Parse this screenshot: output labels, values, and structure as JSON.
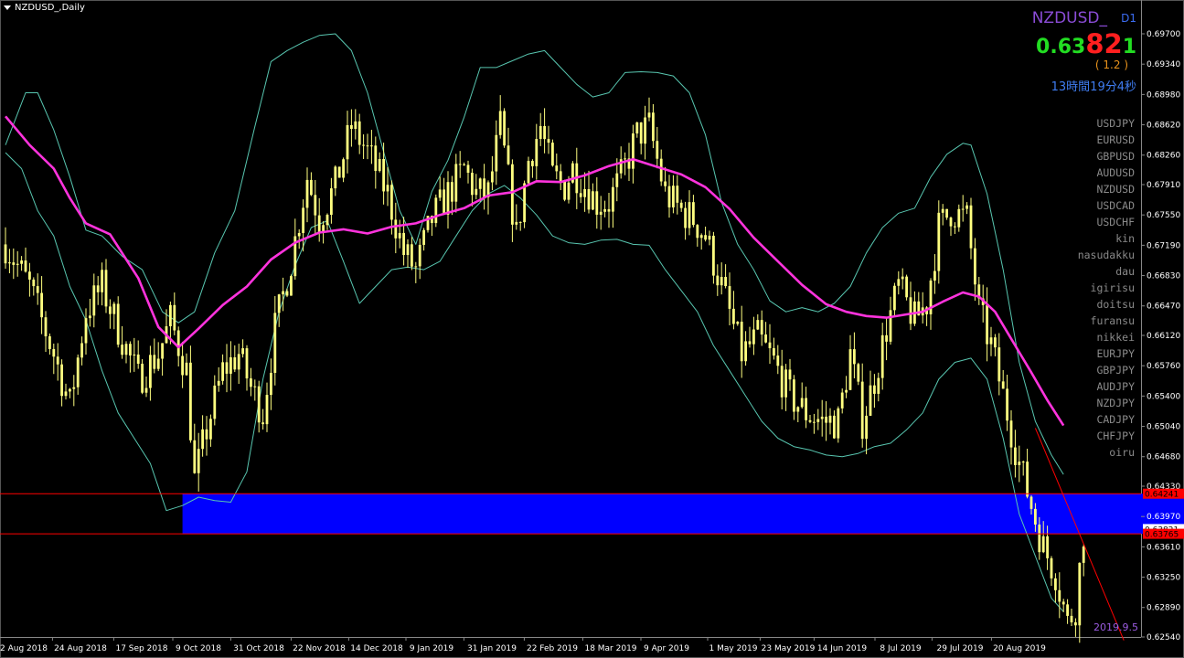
{
  "window": {
    "title": "NZDUSD_,Daily"
  },
  "info": {
    "symbol": "NZDUSD_",
    "timeframe": "D1",
    "bid_main": "0.63",
    "bid_big": "82",
    "bid_last": "1",
    "spread": "( 1.2 )",
    "timer": "13時間19分4秒"
  },
  "pairs": [
    "USDJPY",
    "EURUSD",
    "GBPUSD",
    "AUDUSD",
    "NZDUSD",
    "USDCAD",
    "USDCHF",
    "kin",
    "nasudakku",
    "dau",
    "igirisu",
    "doitsu",
    "furansu",
    "nikkei",
    "EURJPY",
    "GBPJPY",
    "AUDJPY",
    "NZDJPY",
    "CADJPY",
    "CHFJPY",
    "oiru"
  ],
  "date_stamp": "2019.9.5",
  "colors": {
    "background": "#000000",
    "candles": "#ffff80",
    "ma": "#ff33dd",
    "bands": "#58c6b0",
    "zone": "#0000ff",
    "levels": "#ff0000"
  },
  "chart_data": {
    "type": "candlestick",
    "title": "NZDUSD_,Daily",
    "price_ticks": [
      "0.69700",
      "0.69340",
      "0.68980",
      "0.68620",
      "0.68260",
      "0.67910",
      "0.67550",
      "0.67190",
      "0.66830",
      "0.66470",
      "0.66120",
      "0.65760",
      "0.65400",
      "0.65040",
      "0.64680",
      "0.64330",
      "0.63970",
      "0.63610",
      "0.63250",
      "0.62890",
      "0.62540"
    ],
    "ylim": [
      0.6254,
      0.697
    ],
    "date_ticks": [
      "2 Aug 2018",
      "24 Aug 2018",
      "17 Sep 2018",
      "9 Oct 2018",
      "31 Oct 2018",
      "22 Nov 2018",
      "14 Dec 2018",
      "9 Jan 2019",
      "31 Jan 2019",
      "22 Feb 2019",
      "18 Mar 2019",
      "9 Apr 2019",
      "1 May 2019",
      "23 May 2019",
      "14 Jun 2019",
      "8 Jul 2019",
      "29 Jul 2019",
      "20 Aug 2019"
    ],
    "close_path": [
      [
        0,
        0.672
      ],
      [
        6,
        0.667
      ],
      [
        12,
        0.659
      ],
      [
        16,
        0.653
      ],
      [
        20,
        0.664
      ],
      [
        24,
        0.667
      ],
      [
        28,
        0.662
      ],
      [
        33,
        0.656
      ],
      [
        38,
        0.659
      ],
      [
        41,
        0.663
      ],
      [
        45,
        0.657
      ],
      [
        47,
        0.644
      ],
      [
        50,
        0.65
      ],
      [
        54,
        0.657
      ],
      [
        58,
        0.659
      ],
      [
        61,
        0.655
      ],
      [
        64,
        0.652
      ],
      [
        67,
        0.662
      ],
      [
        71,
        0.67
      ],
      [
        75,
        0.68
      ],
      [
        78,
        0.675
      ],
      [
        82,
        0.679
      ],
      [
        86,
        0.686
      ],
      [
        90,
        0.683
      ],
      [
        95,
        0.678
      ],
      [
        99,
        0.671
      ],
      [
        102,
        0.669
      ],
      [
        106,
        0.675
      ],
      [
        110,
        0.678
      ],
      [
        114,
        0.681
      ],
      [
        117,
        0.678
      ],
      [
        120,
        0.678
      ],
      [
        123,
        0.686
      ],
      [
        127,
        0.673
      ],
      [
        130,
        0.682
      ],
      [
        133,
        0.686
      ],
      [
        136,
        0.68
      ],
      [
        139,
        0.679
      ],
      [
        141,
        0.681
      ],
      [
        144,
        0.679
      ],
      [
        147,
        0.677
      ],
      [
        150,
        0.677
      ],
      [
        153,
        0.68
      ],
      [
        157,
        0.685
      ],
      [
        160,
        0.686
      ],
      [
        162,
        0.682
      ],
      [
        164,
        0.678
      ],
      [
        168,
        0.676
      ],
      [
        171,
        0.675
      ],
      [
        174,
        0.673
      ],
      [
        178,
        0.667
      ],
      [
        183,
        0.659
      ],
      [
        187,
        0.661
      ],
      [
        191,
        0.658
      ],
      [
        195,
        0.654
      ],
      [
        199,
        0.652
      ],
      [
        203,
        0.651
      ],
      [
        207,
        0.651
      ],
      [
        210,
        0.659
      ],
      [
        213,
        0.651
      ],
      [
        216,
        0.656
      ],
      [
        219,
        0.662
      ],
      [
        222,
        0.667
      ],
      [
        226,
        0.663
      ],
      [
        229,
        0.665
      ],
      [
        232,
        0.674
      ],
      [
        235,
        0.676
      ],
      [
        239,
        0.675
      ],
      [
        242,
        0.664
      ],
      [
        245,
        0.66
      ],
      [
        248,
        0.654
      ],
      [
        252,
        0.646
      ],
      [
        255,
        0.641
      ],
      [
        258,
        0.636
      ],
      [
        261,
        0.633
      ],
      [
        264,
        0.627
      ],
      [
        266,
        0.629
      ],
      [
        268,
        0.638
      ]
    ],
    "ma_path": [
      [
        0,
        0.6872
      ],
      [
        6,
        0.6838
      ],
      [
        12,
        0.681
      ],
      [
        16,
        0.6775
      ],
      [
        20,
        0.6745
      ],
      [
        26,
        0.6732
      ],
      [
        33,
        0.668
      ],
      [
        38,
        0.6622
      ],
      [
        43,
        0.6598
      ],
      [
        48,
        0.662
      ],
      [
        54,
        0.6648
      ],
      [
        60,
        0.667
      ],
      [
        66,
        0.6702
      ],
      [
        72,
        0.6722
      ],
      [
        78,
        0.6734
      ],
      [
        84,
        0.6738
      ],
      [
        90,
        0.6733
      ],
      [
        96,
        0.6741
      ],
      [
        102,
        0.6745
      ],
      [
        108,
        0.6755
      ],
      [
        114,
        0.6763
      ],
      [
        120,
        0.6778
      ],
      [
        126,
        0.6782
      ],
      [
        132,
        0.6795
      ],
      [
        138,
        0.6794
      ],
      [
        144,
        0.6802
      ],
      [
        150,
        0.6813
      ],
      [
        156,
        0.6821
      ],
      [
        162,
        0.6812
      ],
      [
        168,
        0.6803
      ],
      [
        174,
        0.6788
      ],
      [
        180,
        0.6762
      ],
      [
        186,
        0.6728
      ],
      [
        192,
        0.67
      ],
      [
        198,
        0.6672
      ],
      [
        204,
        0.6649
      ],
      [
        209,
        0.664
      ],
      [
        214,
        0.6635
      ],
      [
        219,
        0.6633
      ],
      [
        224,
        0.6637
      ],
      [
        228,
        0.664
      ],
      [
        233,
        0.6652
      ],
      [
        238,
        0.6663
      ],
      [
        242,
        0.6658
      ],
      [
        246,
        0.664
      ],
      [
        250,
        0.6608
      ],
      [
        255,
        0.6568
      ],
      [
        259,
        0.6535
      ],
      [
        263,
        0.6505
      ]
    ],
    "upper_band_path": [
      [
        0,
        0.6838
      ],
      [
        5,
        0.69
      ],
      [
        8,
        0.69
      ],
      [
        12,
        0.6856
      ],
      [
        16,
        0.68
      ],
      [
        20,
        0.6737
      ],
      [
        24,
        0.673
      ],
      [
        29,
        0.6706
      ],
      [
        34,
        0.669
      ],
      [
        39,
        0.664
      ],
      [
        43,
        0.6627
      ],
      [
        47,
        0.664
      ],
      [
        52,
        0.671
      ],
      [
        57,
        0.676
      ],
      [
        62,
        0.686
      ],
      [
        66,
        0.6937
      ],
      [
        70,
        0.695
      ],
      [
        74,
        0.696
      ],
      [
        78,
        0.6968
      ],
      [
        82,
        0.697
      ],
      [
        86,
        0.695
      ],
      [
        90,
        0.69
      ],
      [
        94,
        0.683
      ],
      [
        98,
        0.676
      ],
      [
        102,
        0.672
      ],
      [
        106,
        0.6783
      ],
      [
        110,
        0.682
      ],
      [
        114,
        0.6871
      ],
      [
        118,
        0.693
      ],
      [
        122,
        0.693
      ],
      [
        126,
        0.6938
      ],
      [
        130,
        0.6946
      ],
      [
        134,
        0.695
      ],
      [
        138,
        0.693
      ],
      [
        142,
        0.691
      ],
      [
        146,
        0.6895
      ],
      [
        150,
        0.69
      ],
      [
        154,
        0.6924
      ],
      [
        158,
        0.6925
      ],
      [
        162,
        0.6924
      ],
      [
        166,
        0.692
      ],
      [
        170,
        0.69
      ],
      [
        174,
        0.685
      ],
      [
        178,
        0.677
      ],
      [
        182,
        0.672
      ],
      [
        186,
        0.669
      ],
      [
        190,
        0.6653
      ],
      [
        194,
        0.664
      ],
      [
        198,
        0.6645
      ],
      [
        202,
        0.664
      ],
      [
        206,
        0.665
      ],
      [
        210,
        0.667
      ],
      [
        214,
        0.671
      ],
      [
        218,
        0.674
      ],
      [
        222,
        0.6757
      ],
      [
        226,
        0.6763
      ],
      [
        230,
        0.68
      ],
      [
        234,
        0.6827
      ],
      [
        238,
        0.684
      ],
      [
        240,
        0.6838
      ],
      [
        244,
        0.678
      ],
      [
        248,
        0.669
      ],
      [
        252,
        0.658
      ],
      [
        256,
        0.651
      ],
      [
        260,
        0.647
      ],
      [
        263,
        0.6447
      ]
    ],
    "lower_band_path": [
      [
        0,
        0.6829
      ],
      [
        4,
        0.681
      ],
      [
        8,
        0.676
      ],
      [
        12,
        0.673
      ],
      [
        16,
        0.667
      ],
      [
        20,
        0.663
      ],
      [
        24,
        0.657
      ],
      [
        28,
        0.652
      ],
      [
        32,
        0.649
      ],
      [
        36,
        0.646
      ],
      [
        40,
        0.6404
      ],
      [
        44,
        0.641
      ],
      [
        48,
        0.642
      ],
      [
        52,
        0.6416
      ],
      [
        56,
        0.6414
      ],
      [
        60,
        0.645
      ],
      [
        64,
        0.656
      ],
      [
        68,
        0.664
      ],
      [
        72,
        0.6695
      ],
      [
        76,
        0.674
      ],
      [
        80,
        0.6748
      ],
      [
        84,
        0.67
      ],
      [
        88,
        0.665
      ],
      [
        92,
        0.667
      ],
      [
        96,
        0.669
      ],
      [
        100,
        0.6693
      ],
      [
        104,
        0.669
      ],
      [
        108,
        0.67
      ],
      [
        112,
        0.673
      ],
      [
        116,
        0.676
      ],
      [
        120,
        0.678
      ],
      [
        124,
        0.679
      ],
      [
        128,
        0.6775
      ],
      [
        132,
        0.6755
      ],
      [
        136,
        0.673
      ],
      [
        140,
        0.6722
      ],
      [
        144,
        0.672
      ],
      [
        148,
        0.6725
      ],
      [
        152,
        0.6726
      ],
      [
        156,
        0.672
      ],
      [
        160,
        0.6719
      ],
      [
        164,
        0.669
      ],
      [
        168,
        0.6665
      ],
      [
        172,
        0.664
      ],
      [
        176,
        0.66
      ],
      [
        180,
        0.657
      ],
      [
        184,
        0.654
      ],
      [
        188,
        0.651
      ],
      [
        192,
        0.649
      ],
      [
        196,
        0.648
      ],
      [
        200,
        0.6476
      ],
      [
        204,
        0.647
      ],
      [
        208,
        0.6468
      ],
      [
        212,
        0.6472
      ],
      [
        216,
        0.648
      ],
      [
        220,
        0.6484
      ],
      [
        224,
        0.65
      ],
      [
        228,
        0.652
      ],
      [
        232,
        0.656
      ],
      [
        236,
        0.658
      ],
      [
        240,
        0.6585
      ],
      [
        244,
        0.656
      ],
      [
        248,
        0.649
      ],
      [
        252,
        0.64
      ],
      [
        256,
        0.635
      ],
      [
        260,
        0.63
      ],
      [
        263,
        0.6284
      ]
    ],
    "zone": {
      "top": 0.64241,
      "bottom": 0.63765,
      "label_top": "0.64241",
      "label_bottom": "0.63765",
      "from_x": 44,
      "to_x": 297
    },
    "trendline": [
      [
        256,
        0.6502
      ],
      [
        278,
        0.625
      ]
    ],
    "current_price": "0.63821",
    "price_label_top": "0.64241",
    "price_label_bottom": "0.63765"
  }
}
